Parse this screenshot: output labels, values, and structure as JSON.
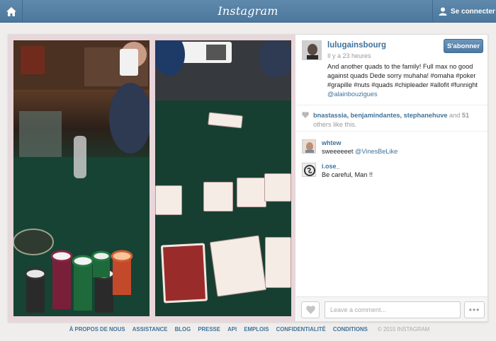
{
  "topbar": {
    "brand": "Instagram",
    "home_icon": "home-icon",
    "connect_label": "Se connecter",
    "user_icon": "user-icon"
  },
  "post": {
    "username": "lulugainsbourg",
    "time": "Il y a 23 heures",
    "follow_label": "S'abonner",
    "caption": "And another quads to the family! Full max no good against quads Dede sorry muhaha! #omaha #poker #grapille #nuts #quads #chipleader #allofit #funnight",
    "caption_mention": "@alainbouzigues",
    "likers": "bnastassia, benjamindantes, stephanehuve",
    "likes_and": "and",
    "likes_count": "51",
    "likes_suffix": "others like this.",
    "comments": [
      {
        "user": "whtew",
        "text": "sweeeeeet",
        "tag": "@VinesBeLike"
      },
      {
        "user": "i.ose_",
        "text": "Be careful, Man !!",
        "tag": ""
      }
    ],
    "comment_placeholder": "Leave a comment...",
    "more_label": "•••"
  },
  "footer": {
    "links": [
      "À PROPOS DE NOUS",
      "ASSISTANCE",
      "BLOG",
      "PRESSE",
      "API",
      "EMPLOIS",
      "CONFIDENTIALITÉ",
      "CONDITIONS"
    ],
    "copyright": "© 2015 INSTAGRAM"
  },
  "colors": {
    "topbar": "#517fa4",
    "link": "#3f729b",
    "follow_button": "#5a86ae"
  }
}
